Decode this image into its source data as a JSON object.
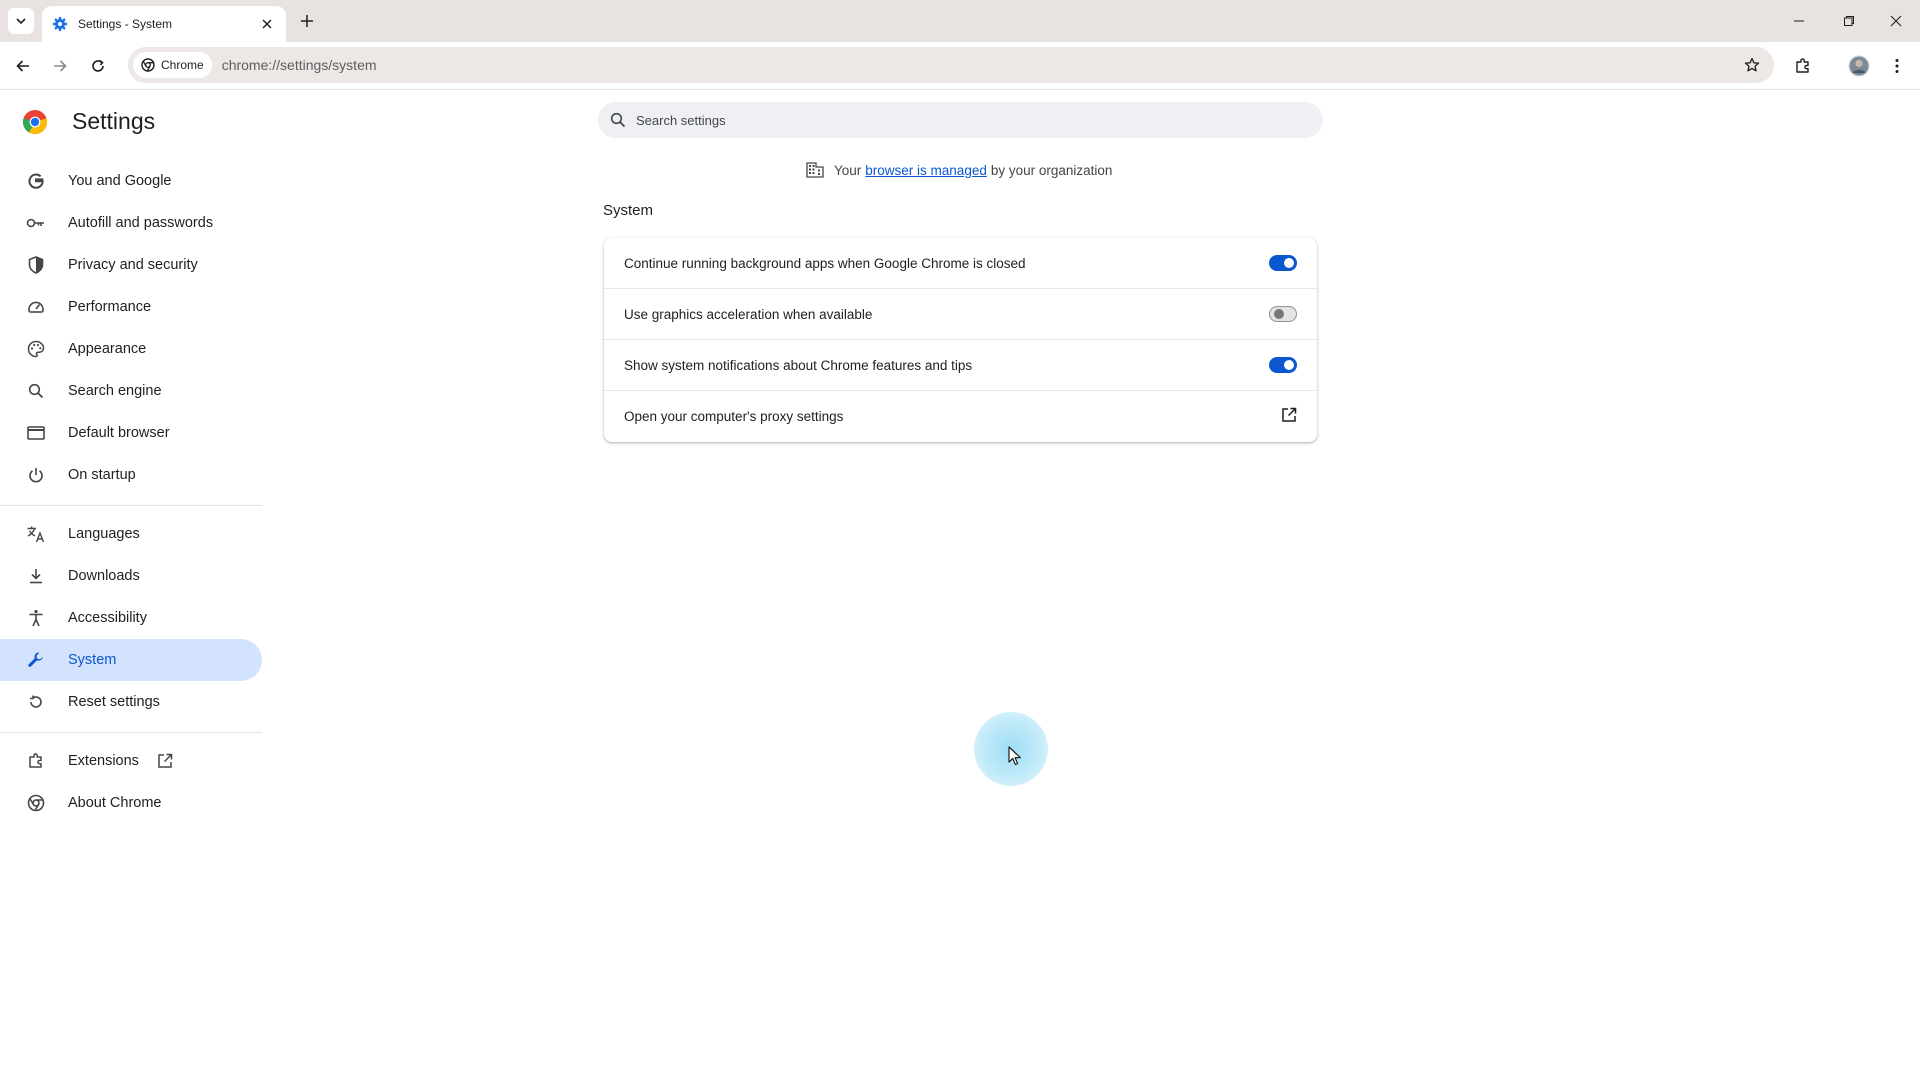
{
  "browser": {
    "tab": {
      "title": "Settings - System",
      "favicon": "gear-icon"
    },
    "toolbar": {
      "chip_label": "Chrome",
      "url": "chrome://settings/system"
    }
  },
  "settings": {
    "title": "Settings",
    "search_placeholder": "Search settings",
    "nav_primary": [
      {
        "label": "You and Google",
        "icon": "google-g-icon"
      },
      {
        "label": "Autofill and passwords",
        "icon": "key-icon"
      },
      {
        "label": "Privacy and security",
        "icon": "shield-icon"
      },
      {
        "label": "Performance",
        "icon": "speedometer-icon"
      },
      {
        "label": "Appearance",
        "icon": "palette-icon"
      },
      {
        "label": "Search engine",
        "icon": "search-icon"
      },
      {
        "label": "Default browser",
        "icon": "browser-window-icon"
      },
      {
        "label": "On startup",
        "icon": "power-icon"
      }
    ],
    "nav_secondary": [
      {
        "label": "Languages",
        "icon": "translate-icon"
      },
      {
        "label": "Downloads",
        "icon": "download-icon"
      },
      {
        "label": "Accessibility",
        "icon": "accessibility-icon"
      },
      {
        "label": "System",
        "icon": "wrench-icon",
        "active": true
      },
      {
        "label": "Reset settings",
        "icon": "reset-icon"
      }
    ],
    "nav_tertiary": [
      {
        "label": "Extensions",
        "icon": "puzzle-icon"
      },
      {
        "label": "About Chrome",
        "icon": "chrome-icon"
      }
    ],
    "managed": {
      "prefix": "Your",
      "link": "browser is managed",
      "suffix": "by your organization"
    },
    "section_title": "System",
    "rows": [
      {
        "label": "Continue running background apps when Google Chrome is closed",
        "control": "toggle",
        "enabled": true
      },
      {
        "label": "Use graphics acceleration when available",
        "control": "toggle",
        "enabled": false
      },
      {
        "label": "Show system notifications about Chrome features and tips",
        "control": "toggle",
        "enabled": true
      },
      {
        "label": "Open your computer's proxy settings",
        "control": "external-link"
      }
    ]
  },
  "colors": {
    "accent": "#0b57d0",
    "active_nav_bg": "#d3e3fd",
    "tabstrip_bg": "#e8e2e1"
  }
}
